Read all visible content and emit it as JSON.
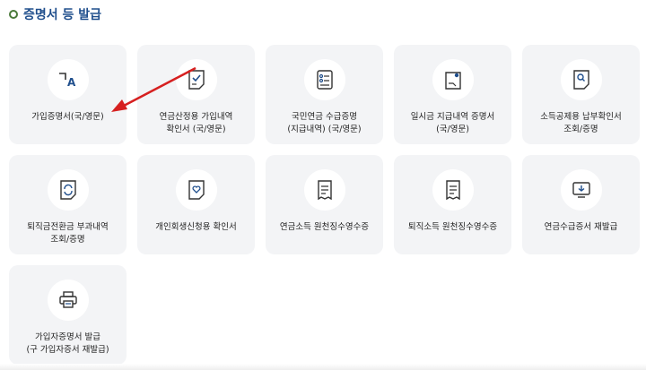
{
  "section": {
    "title": "증명서 등 발급"
  },
  "cards": [
    {
      "label": "가입증명서(국/영문)",
      "icon": "translate-icon"
    },
    {
      "label": "연금산정용 가입내역\n확인서 (국/영문)",
      "icon": "document-check-icon"
    },
    {
      "label": "국민연금 수급증명\n(지급내역) (국/영문)",
      "icon": "document-list-icon"
    },
    {
      "label": "일시금 지급내역 증명서\n(국/영문)",
      "icon": "document-stamp-icon"
    },
    {
      "label": "소득공제용 납부확인서\n조회/증명",
      "icon": "document-search-icon"
    },
    {
      "label": "퇴직금전환금 부과내역\n조회/증명",
      "icon": "document-refresh-icon"
    },
    {
      "label": "개인회생신청용 확인서",
      "icon": "document-heart-icon"
    },
    {
      "label": "연금소득 원천징수영수증",
      "icon": "receipt-icon"
    },
    {
      "label": "퇴직소득 원천징수영수증",
      "icon": "receipt-icon"
    },
    {
      "label": "연금수급증서 재발급",
      "icon": "download-monitor-icon"
    },
    {
      "label": "가입자증명서 발급\n(구 가입자증서 재발급)",
      "icon": "printer-icon"
    }
  ],
  "colors": {
    "accent": "#1f4e8c",
    "arrow": "#d62020",
    "card_bg": "#f3f4f6"
  }
}
